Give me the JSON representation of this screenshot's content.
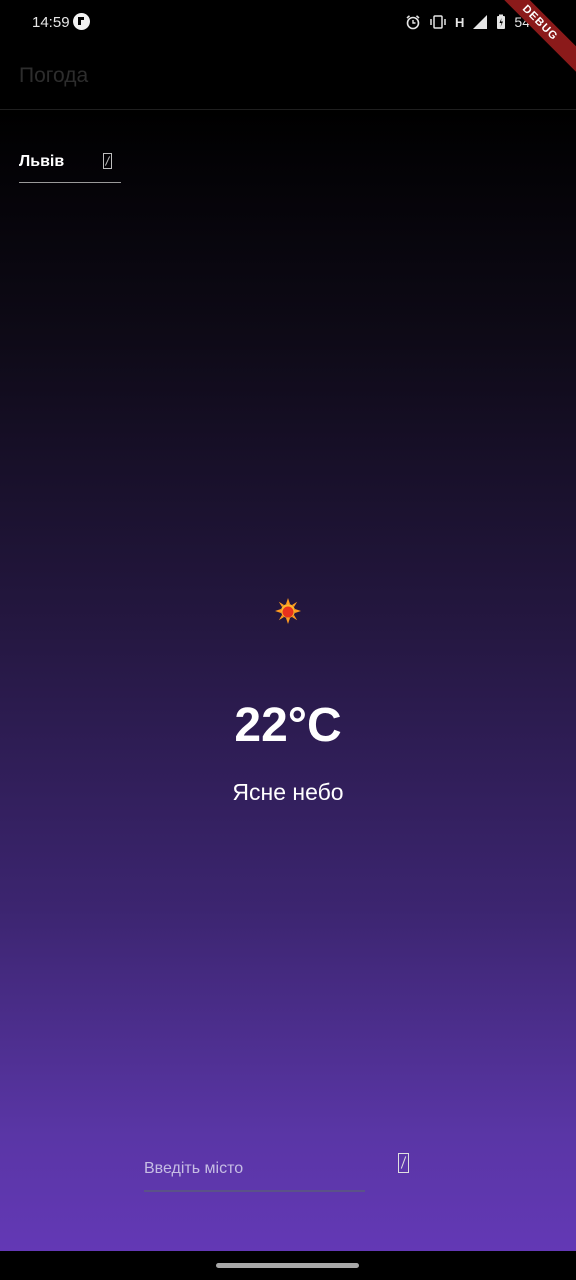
{
  "status_bar": {
    "time": "14:59",
    "network_label": "H",
    "battery_level": "54"
  },
  "debug_banner": "DEBUG",
  "app_bar": {
    "title": "Погода"
  },
  "city_selector": {
    "selected": "Львів",
    "icon": "dropdown-icon"
  },
  "weather": {
    "icon": "sun-icon",
    "temperature": "22°C",
    "condition": "Ясне небо"
  },
  "city_input": {
    "placeholder": "Введіть місто",
    "value": "",
    "search_icon": "search-icon"
  },
  "colors": {
    "gradient_top": "#000000",
    "gradient_bottom": "#6338b5",
    "text": "#ffffff",
    "debug_ribbon": "#8b1a1a"
  }
}
